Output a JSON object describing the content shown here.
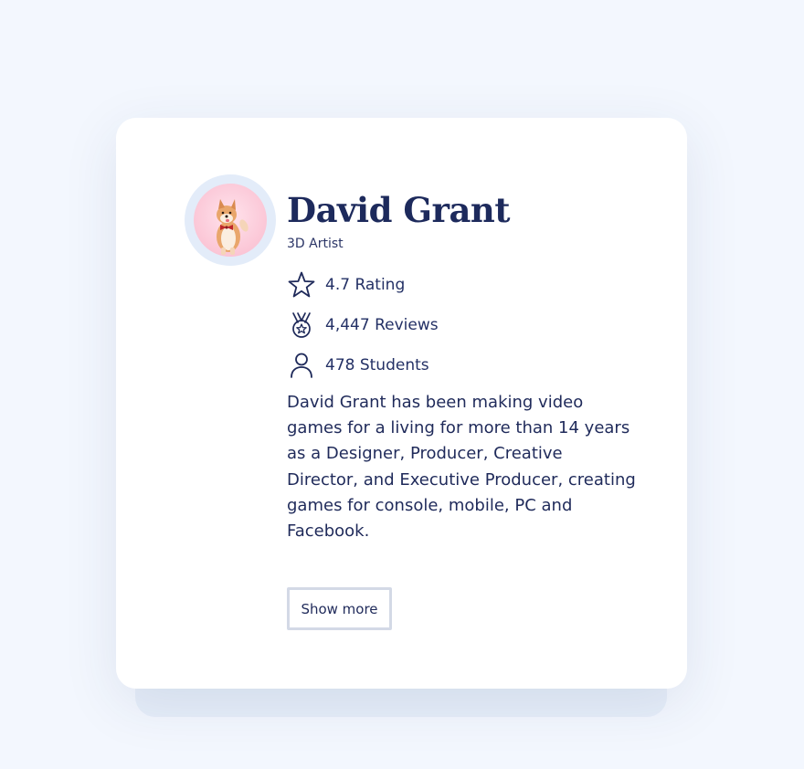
{
  "profile": {
    "name": "David Grant",
    "role": "3D Artist",
    "avatar_icon": "dog-avatar-icon"
  },
  "stats": {
    "rating": {
      "icon": "star-icon",
      "label": "4.7 Rating"
    },
    "reviews": {
      "icon": "medal-icon",
      "label": "4,447 Reviews"
    },
    "students": {
      "icon": "user-icon",
      "label": "478 Students"
    }
  },
  "bio": "David Grant has been making video games for a living for more than 14 years as a Designer, Producer, Creative Director, and Executive Producer, creating games for console, mobile, PC and Facebook.",
  "actions": {
    "show_more_label": "Show more"
  },
  "colors": {
    "page_background": "#f3f7fe",
    "card_background": "#ffffff",
    "text_primary": "#1d2a5c",
    "avatar_ring": "#e3ecf9",
    "button_border": "#d3d9e6"
  }
}
